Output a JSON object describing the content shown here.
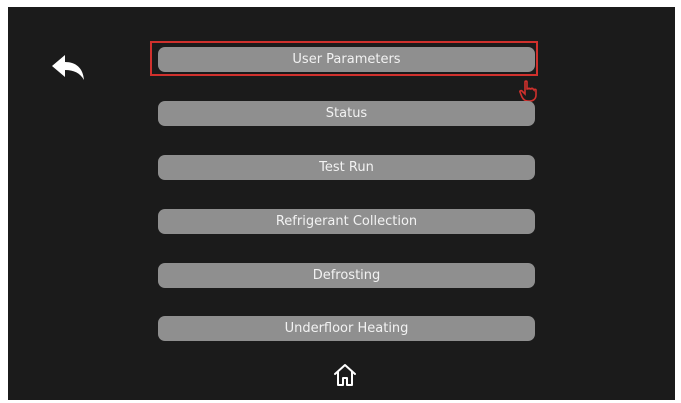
{
  "screen": {
    "background": "#1b1b1b",
    "accent_highlight": "#d0312d"
  },
  "nav": {
    "back_icon": "back-arrow-icon",
    "home_icon": "home-icon"
  },
  "menu": {
    "items": [
      {
        "label": "User Parameters",
        "selected": true
      },
      {
        "label": "Status"
      },
      {
        "label": "Test Run"
      },
      {
        "label": "Refrigerant Collection"
      },
      {
        "label": "Defrosting"
      },
      {
        "label": "Underfloor Heating"
      }
    ]
  },
  "cursor": {
    "icon": "hand-pointer-icon"
  }
}
